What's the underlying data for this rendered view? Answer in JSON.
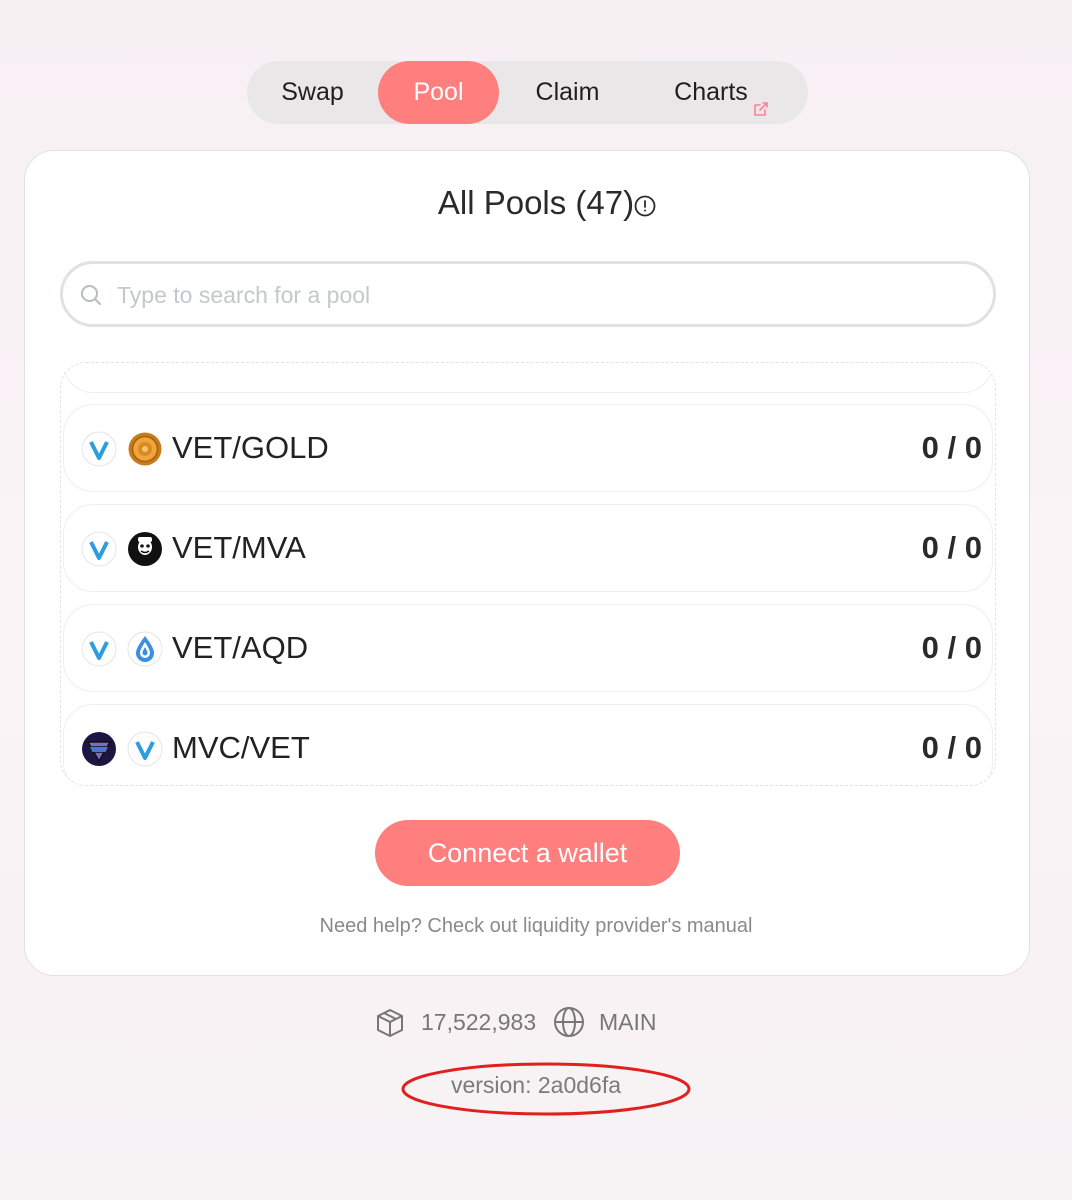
{
  "tabs": {
    "swap": "Swap",
    "pool": "Pool",
    "claim": "Claim",
    "charts": "Charts"
  },
  "card": {
    "title": "All Pools (47)"
  },
  "search": {
    "placeholder": "Type to search for a pool"
  },
  "pools": [
    {
      "pair": "VET/GOLD",
      "amount": "0 / 0",
      "icons": [
        "vet-icon",
        "gold-icon"
      ]
    },
    {
      "pair": "VET/MVA",
      "amount": "0 / 0",
      "icons": [
        "vet-icon",
        "mva-icon"
      ]
    },
    {
      "pair": "VET/AQD",
      "amount": "0 / 0",
      "icons": [
        "vet-icon",
        "aqd-icon"
      ]
    },
    {
      "pair": "MVC/VET",
      "amount": "0 / 0",
      "icons": [
        "mvc-icon",
        "vet-icon"
      ]
    }
  ],
  "connect_label": "Connect a wallet",
  "help_text": "Need help? Check out liquidity provider's manual",
  "footer": {
    "block": "17,522,983",
    "network": "MAIN"
  },
  "version": "version: 2a0d6fa",
  "colors": {
    "accent": "#ff7e7e",
    "vet_blue": "#2e9de0",
    "annotation_red": "#e0201e"
  }
}
